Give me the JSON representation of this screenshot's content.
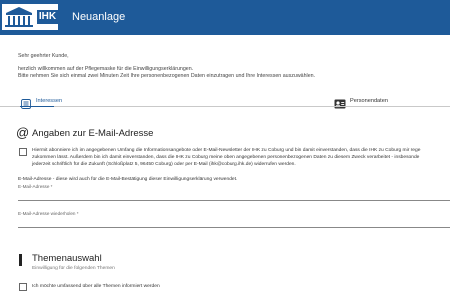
{
  "header": {
    "logo_text": "IHK",
    "title": "Neuanlage"
  },
  "intro": {
    "greeting": "Sehr geehrter Kunde,",
    "line1": "herzlich willkommen auf der Pflegemaske für die Einwilligungserklärungen.",
    "line2": "Bitte nehmen Sie sich einmal zwei Minuten Zeit Ihre personenbezogenen Daten einzutragen und Ihre Interessen auszuwählen."
  },
  "tabs": [
    {
      "label": "Interessen",
      "icon": "list-icon",
      "active": true
    },
    {
      "label": "Personendaten",
      "icon": "id-card-icon",
      "active": false
    }
  ],
  "email_section": {
    "icon": "at-icon",
    "title": "Angaben zur E-Mail-Adresse",
    "consent_lines": [
      "Hiermit abonniere ich im angegebenen Umfang die Informationsangebote oder E-Mail-Newsletter der IHK zu Coburg und bin damit einverstanden, dass die IHK zu Coburg mir rege",
      "zukommen lässt. Außerdem bin ich damit einverstanden, dass die IHK zu Coburg meine oben angegebenen personenbezogenen Daten zu diesem Zweck verarbeitet - insbesonde",
      "jederzeit schriftlich für die Zukunft (Schloßplatz 5, 96450 Coburg) oder per E-Mail (ihk@coburg.ihk.de) widerrufen werden."
    ],
    "info": "E-Mail-Adresse - diese wird auch für die E-Mail-Bestätigung dieser Einwilligungserklärung verwendet.",
    "email_label": "E-Mail-Adresse *",
    "email_repeat_label": "E-Mail-Adresse wiederholen *"
  },
  "themen_section": {
    "title": "Themenauswahl",
    "subtitle": "Einwilligung für die folgenden Themen",
    "all_topics_label": "Ich möchte umfassend über alle Themen informiert werden"
  },
  "colors": {
    "header_bg": "#1e5a99",
    "accent": "#1e5a99"
  }
}
